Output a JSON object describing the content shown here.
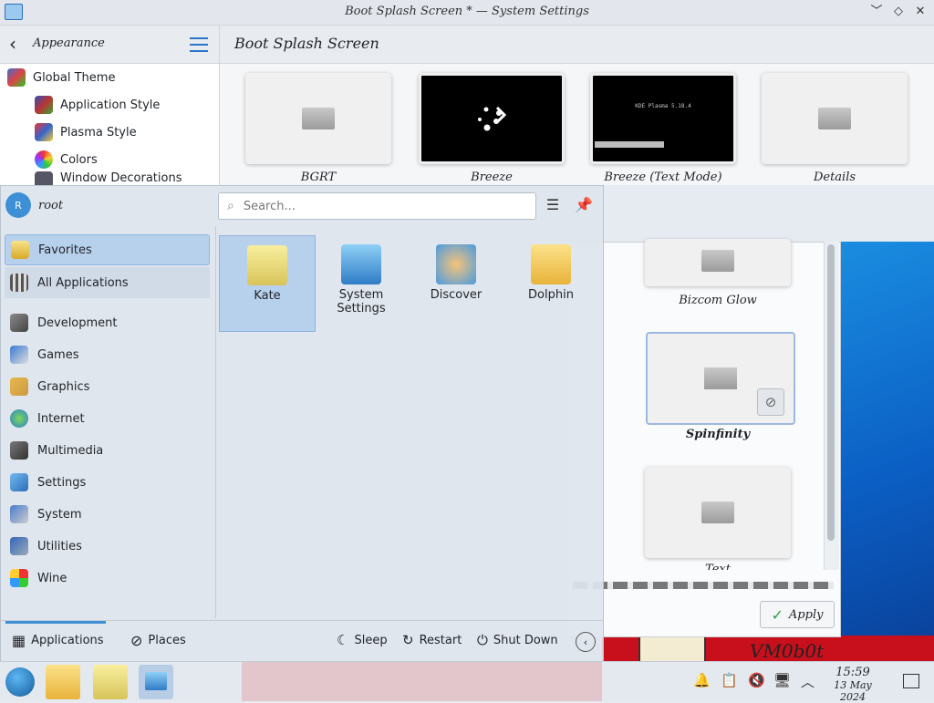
{
  "window": {
    "title": "Boot Splash Screen * — System Settings",
    "controls": [
      "﹀",
      "◇",
      "✕"
    ]
  },
  "sidebar": {
    "back_label": "Appearance",
    "items": [
      {
        "label": "Global Theme"
      },
      {
        "label": "Application Style"
      },
      {
        "label": "Plasma Style"
      },
      {
        "label": "Colors"
      },
      {
        "label": "Window Decorations"
      }
    ]
  },
  "content": {
    "title": "Boot Splash Screen",
    "themes": [
      {
        "label": "BGRT"
      },
      {
        "label": "Breeze"
      },
      {
        "label": "Breeze (Text Mode)",
        "preview_text": "KDE Plasma 5.18.4"
      },
      {
        "label": "Details"
      }
    ]
  },
  "dialog": {
    "themes": [
      "Bizcom Glow",
      "Spinfinity",
      "Text"
    ],
    "apply_label": "Apply"
  },
  "launcher": {
    "user": {
      "initial": "R",
      "name": "root"
    },
    "search_placeholder": "Search...",
    "categories": [
      {
        "label": "Favorites",
        "icon": "favorites-icon"
      },
      {
        "label": "All Applications",
        "icon": "all-applications-icon"
      },
      {
        "label": "Development",
        "icon": "development-icon"
      },
      {
        "label": "Games",
        "icon": "games-icon"
      },
      {
        "label": "Graphics",
        "icon": "graphics-icon"
      },
      {
        "label": "Internet",
        "icon": "internet-icon"
      },
      {
        "label": "Multimedia",
        "icon": "multimedia-icon"
      },
      {
        "label": "Settings",
        "icon": "settings-icon"
      },
      {
        "label": "System",
        "icon": "system-icon"
      },
      {
        "label": "Utilities",
        "icon": "utilities-icon"
      },
      {
        "label": "Wine",
        "icon": "wine-icon"
      }
    ],
    "apps": [
      {
        "label": "Kate"
      },
      {
        "label": "System Settings"
      },
      {
        "label": "Discover"
      },
      {
        "label": "Dolphin"
      }
    ],
    "footer": {
      "applications": "Applications",
      "places": "Places",
      "sleep": "Sleep",
      "restart": "Restart",
      "shutdown": "Shut Down"
    }
  },
  "desktop": {
    "wallpaper_text": "VM0b0t"
  },
  "taskbar": {
    "time": "15:59",
    "date": "13 May 2024"
  },
  "colors": {
    "accent": "#3d8fd6",
    "selection": "#9cc0ea"
  }
}
